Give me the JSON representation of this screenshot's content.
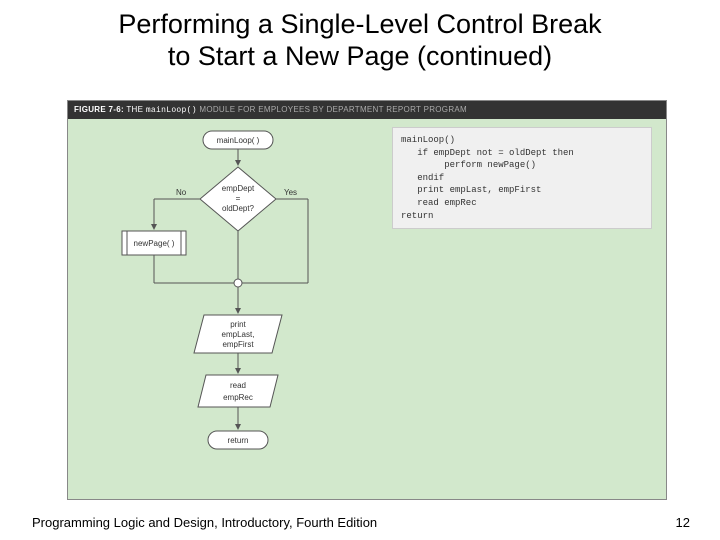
{
  "title_line1": "Performing a Single-Level Control Break",
  "title_line2": "to Start  a New Page (continued)",
  "figure": {
    "label": "FIGURE 7-6:",
    "code": "mainLoop()",
    "rest": "MODULE FOR EMPLOYEES BY DEPARTMENT REPORT PROGRAM"
  },
  "flowchart": {
    "start": "mainLoop( )",
    "decision_l1": "empDept",
    "decision_l2": "=",
    "decision_l3": "oldDept?",
    "no": "No",
    "yes": "Yes",
    "subprocess": "newPage( )",
    "print_l1": "print",
    "print_l2": "empLast,",
    "print_l3": "empFirst",
    "read_l1": "read",
    "read_l2": "empRec",
    "return": "return"
  },
  "pseudocode": "mainLoop()\n   if empDept not = oldDept then\n        perform newPage()\n   endif\n   print empLast, empFirst\n   read empRec\nreturn",
  "footer": {
    "left": "Programming Logic and Design, Introductory, Fourth Edition",
    "page": "12"
  }
}
